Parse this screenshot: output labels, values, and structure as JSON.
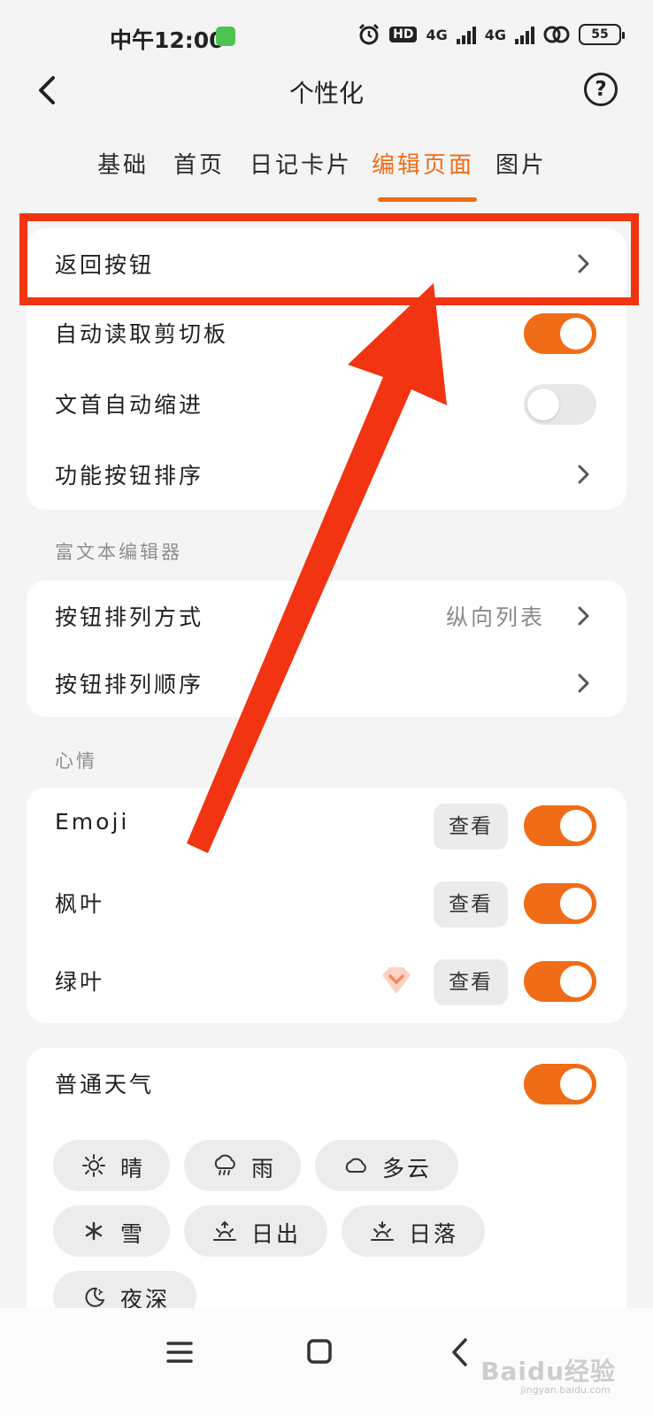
{
  "status_bar": {
    "time": "中午12:00",
    "hd": "HD",
    "network_1": "4G",
    "network_2": "4G",
    "battery": "55"
  },
  "header": {
    "title": "个性化",
    "help": "?"
  },
  "tabs": [
    {
      "label": "基础",
      "active": false
    },
    {
      "label": "首页",
      "active": false
    },
    {
      "label": "日记卡片",
      "active": false
    },
    {
      "label": "编辑页面",
      "active": true
    },
    {
      "label": "图片",
      "active": false
    }
  ],
  "general": {
    "back_button": {
      "label": "返回按钮"
    },
    "auto_clipboard": {
      "label": "自动读取剪切板",
      "on": true
    },
    "auto_indent": {
      "label": "文首自动缩进",
      "on": false
    },
    "button_order": {
      "label": "功能按钮排序"
    }
  },
  "rich_text": {
    "section_title": "富文本编辑器",
    "layout": {
      "label": "按钮排列方式",
      "value": "纵向列表"
    },
    "order": {
      "label": "按钮排列顺序"
    }
  },
  "mood": {
    "section_title": "心情",
    "items": [
      {
        "label": "Emoji",
        "view": "查看",
        "on": true
      },
      {
        "label": "枫叶",
        "view": "查看",
        "on": true
      },
      {
        "label": "绿叶",
        "view": "查看",
        "on": true,
        "vip": true
      }
    ]
  },
  "weather": {
    "label": "普通天气",
    "on": true,
    "chips": [
      {
        "label": "晴",
        "icon": "sun-icon"
      },
      {
        "label": "雨",
        "icon": "rain-icon"
      },
      {
        "label": "多云",
        "icon": "cloud-icon"
      },
      {
        "label": "雪",
        "icon": "snow-icon"
      },
      {
        "label": "日出",
        "icon": "sunrise-icon"
      },
      {
        "label": "日落",
        "icon": "sunset-icon"
      },
      {
        "label": "夜深",
        "icon": "moon-icon"
      }
    ]
  },
  "annotation_color": "#f23412",
  "accent_color": "#f06c17",
  "watermark": {
    "text": "Baidu经验",
    "sub": "jingyan.baidu.com"
  }
}
